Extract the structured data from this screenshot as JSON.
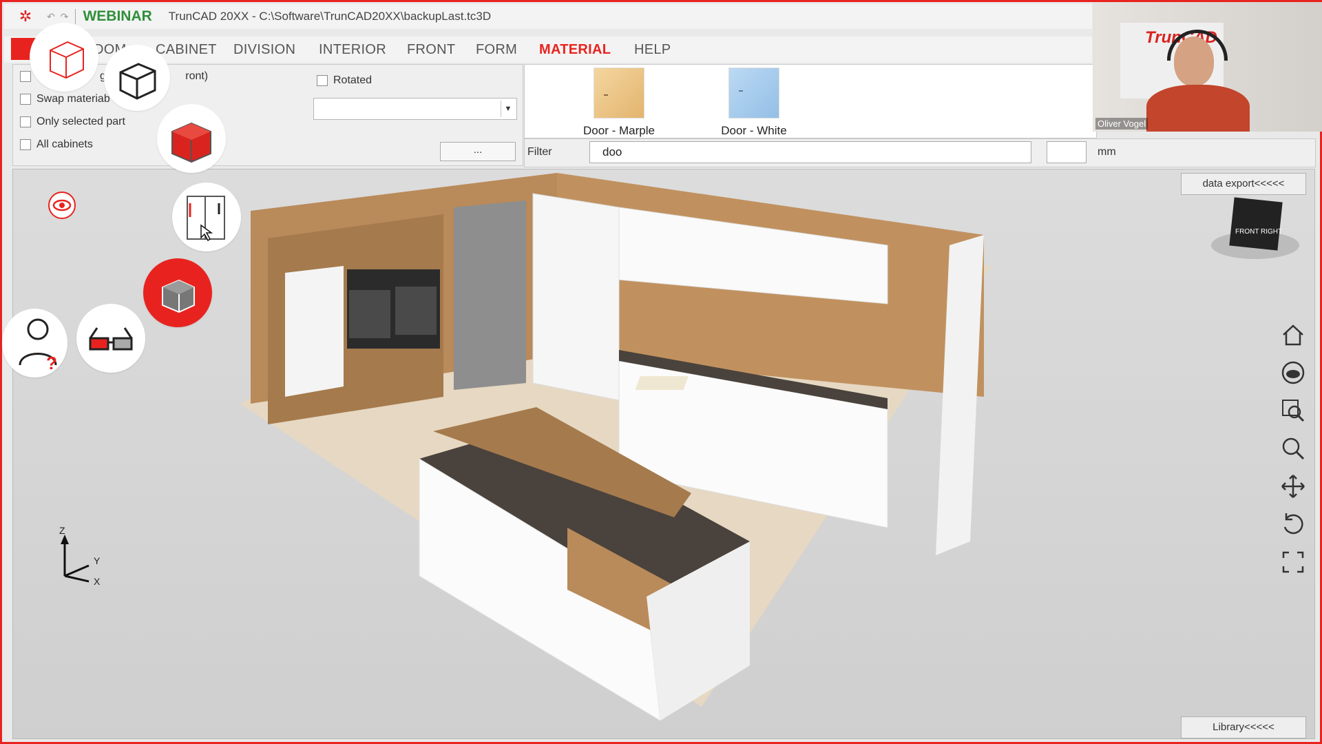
{
  "titlebar": {
    "badge": "WEBINAR",
    "title": "TrunCAD 20XX - C:\\Software\\TrunCAD20XX\\backupLast.tc3D"
  },
  "menu": {
    "items": [
      "DOM",
      "CABINET",
      "DIVISION",
      "INTERIOR",
      "FRONT",
      "FORM",
      "MATERIAL",
      "HELP"
    ],
    "active": "MATERIAL"
  },
  "options": {
    "checkbox_1": "gr",
    "checkbox_1_suffix": "ront)",
    "checkbox_2": "Swap materiab",
    "checkbox_3": "Only selected part",
    "checkbox_4": "All cabinets",
    "rotated": "Rotated",
    "select_value": "",
    "dots_button": "..."
  },
  "gallery": {
    "items": [
      {
        "label": "Door - Marple",
        "color": "#f0c98a"
      },
      {
        "label": "Door - White",
        "color": "#a9cdee"
      }
    ]
  },
  "filter": {
    "label": "Filter",
    "value": "doo",
    "second_value": "",
    "unit": "mm"
  },
  "viewport": {
    "data_export": "data export<<<<<",
    "library": "Library<<<<<",
    "viewcube_front": "FRONT",
    "viewcube_right": "RIGHT",
    "axis_z": "Z",
    "axis_y": "Y",
    "axis_x": "X"
  },
  "webcam": {
    "name": "Oliver Vogel",
    "backdrop_text": "TrunCAD"
  },
  "colors": {
    "accent": "#e8231f",
    "webinar_green": "#2f8f3a",
    "wood": "#b98a5a",
    "floor": "#e6d8c2",
    "countertop": "#4a423c"
  }
}
